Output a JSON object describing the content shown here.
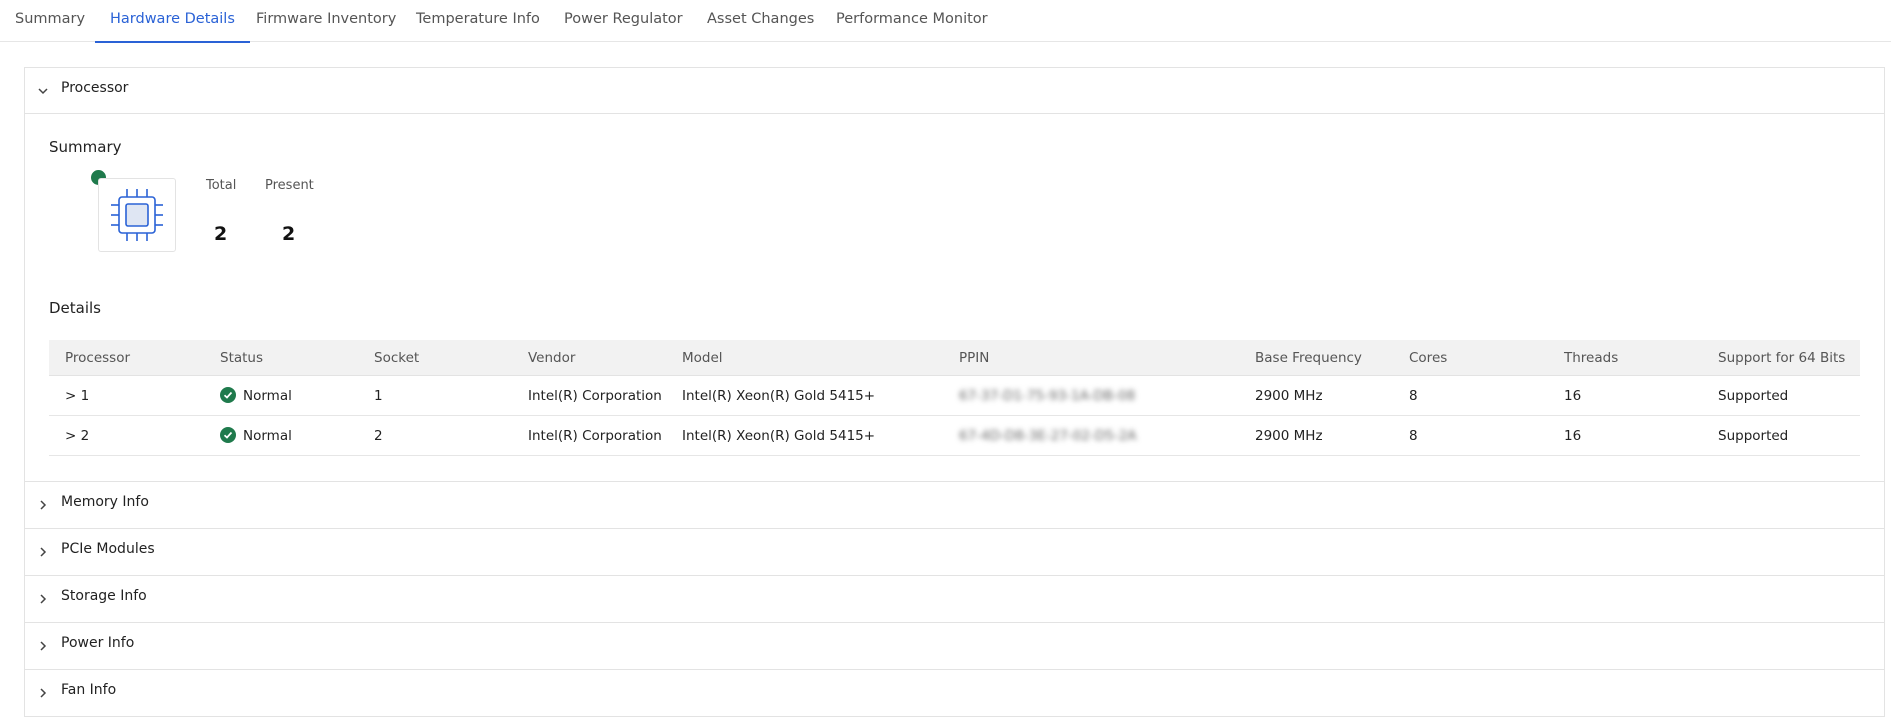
{
  "tabs": [
    {
      "label": "Summary"
    },
    {
      "label": "Hardware Details",
      "active": true
    },
    {
      "label": "Firmware Inventory"
    },
    {
      "label": "Temperature Info"
    },
    {
      "label": "Power Regulator"
    },
    {
      "label": "Asset Changes"
    },
    {
      "label": "Performance Monitor"
    }
  ],
  "processor_panel": {
    "title": "Processor",
    "expanded": true,
    "summary": {
      "label": "Summary",
      "status_color": "#1f7a4c",
      "icon": "cpu-chip-icon",
      "total_label": "Total",
      "total_value": "2",
      "present_label": "Present",
      "present_value": "2"
    },
    "details": {
      "label": "Details",
      "columns": [
        "Processor",
        "Status",
        "Socket",
        "Vendor",
        "Model",
        "PPIN",
        "Base Frequency",
        "Cores",
        "Threads",
        "Support for 64 Bits"
      ],
      "rows": [
        {
          "processor": "> 1",
          "status": "Normal",
          "socket": "1",
          "vendor": "Intel(R) Corporation",
          "model": "Intel(R) Xeon(R) Gold 5415+",
          "ppin": "67-37-D1-75-93-1A-DB-08",
          "base_frequency": "2900 MHz",
          "cores": "8",
          "threads": "16",
          "support_64": "Supported"
        },
        {
          "processor": "> 2",
          "status": "Normal",
          "socket": "2",
          "vendor": "Intel(R) Corporation",
          "model": "Intel(R) Xeon(R) Gold 5415+",
          "ppin": "67-4D-D8-3E-27-02-D5-2A",
          "base_frequency": "2900 MHz",
          "cores": "8",
          "threads": "16",
          "support_64": "Supported"
        }
      ]
    }
  },
  "collapsed_panels": [
    {
      "title": "Memory Info"
    },
    {
      "title": "PCIe Modules"
    },
    {
      "title": "Storage Info"
    },
    {
      "title": "Power Info"
    },
    {
      "title": "Fan Info"
    }
  ],
  "colors": {
    "accent": "#2a62d6",
    "status_normal": "#1f7a4c"
  }
}
